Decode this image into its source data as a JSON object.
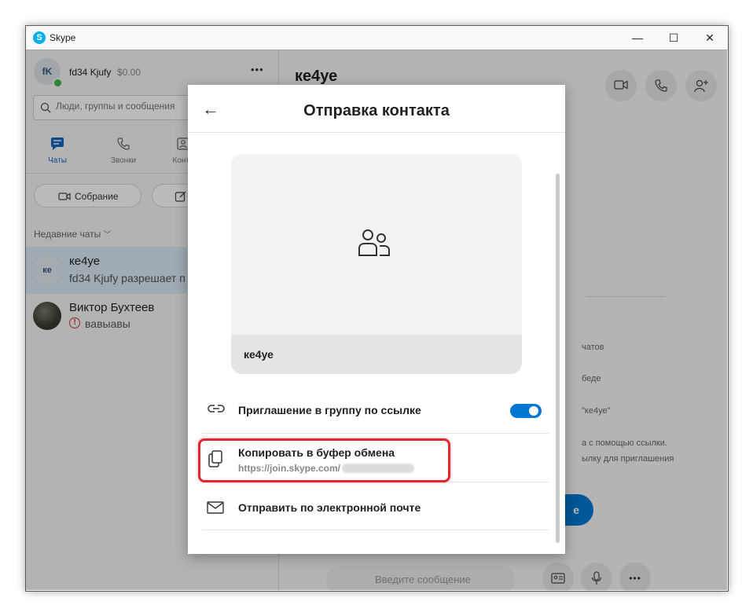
{
  "window": {
    "app_title": "Skype",
    "logo_letter": "S",
    "controls": {
      "minimize": "—",
      "maximize": "☐",
      "close": "✕"
    }
  },
  "profile": {
    "initials": "fK",
    "name": "fd34 Kjufy",
    "balance": "$0.00",
    "more": "•••",
    "status_color": "#3ab44a"
  },
  "search": {
    "placeholder": "Люди, группы и сообщения"
  },
  "nav_tabs": [
    {
      "label": "Чаты",
      "icon": "chat-icon",
      "active": true
    },
    {
      "label": "Звонки",
      "icon": "phone-icon"
    },
    {
      "label": "Конта",
      "icon": "contacts-icon"
    }
  ],
  "buttons": {
    "meeting": "Собрание"
  },
  "recent_header": "Недавние чаты",
  "chats": [
    {
      "initials": "ке",
      "name": "ке4уе",
      "preview": "fd34 Kjufy разрешает п",
      "selected": true
    },
    {
      "name": "Виктор Бухтеев",
      "preview": "вавыавы",
      "warning": true
    }
  ],
  "conversation": {
    "title": "ке4уе",
    "side_snippets": [
      "чатов",
      "беде",
      "\"ке4уе\"",
      "а с помощью ссылки.",
      "ылку для приглашения"
    ],
    "composer_placeholder": "Введите сообщение",
    "send_partial": "е"
  },
  "dialog": {
    "title": "Отправка контакта",
    "back_glyph": "←",
    "card_name": "ке4уе",
    "rows": {
      "invite_link": "Приглашение в группу по ссылке",
      "copy": "Копировать в буфер обмена",
      "copy_url": "https://join.skype.com/",
      "email": "Отправить по электронной почте"
    },
    "invite_toggle_on": true,
    "accent": "#0078d4",
    "highlight_color": "#e3262f"
  }
}
